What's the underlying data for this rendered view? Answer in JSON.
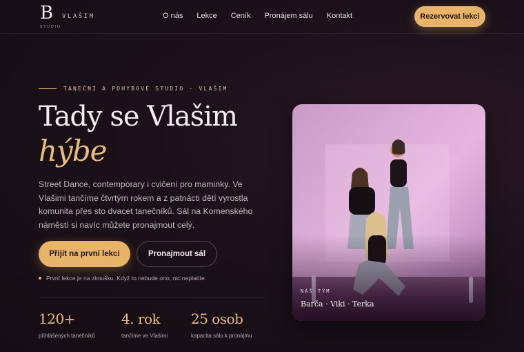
{
  "header": {
    "logo_letter": "B",
    "logo_sub": "STUDIO",
    "brand_name": "VLAŠIM",
    "nav": [
      {
        "label": "O nás"
      },
      {
        "label": "Lekce"
      },
      {
        "label": "Ceník"
      },
      {
        "label": "Pronájem sálu"
      },
      {
        "label": "Kontakt"
      }
    ],
    "cta_label": "Rezervovat lekci"
  },
  "hero": {
    "eyebrow": "TANEČNÍ A POHYBOVÉ STUDIO · VLAŠIM",
    "title_line1": "Tady se Vlašim",
    "title_line2": "hýbe",
    "lead": "Street Dance, contemporary i cvičení pro maminky. Ve Vlašimi tančíme čtvrtým rokem a z patnácti dětí vyrostla komunita přes sto dvacet tanečníků. Sál na Komenského náměstí si navíc můžete pronajmout celý.",
    "primary_button": "Přijít na první lekci",
    "secondary_button": "Pronajmout sál",
    "note": "První lekce je na zkoušku. Když to nebude ono, nic neplatíte."
  },
  "stats": [
    {
      "value": "120+",
      "label": "přihlášených tanečníků"
    },
    {
      "value": "4. rok",
      "label": "tančíme ve Vlašimi"
    },
    {
      "value": "25 osob",
      "label": "kapacita sálu k pronájmu"
    }
  ],
  "team_card": {
    "eyebrow": "NÁŠ TÝM",
    "names": "Barča · Viki · Terka"
  },
  "colors": {
    "accent": "#e7b46a",
    "background": "#1c1119"
  }
}
